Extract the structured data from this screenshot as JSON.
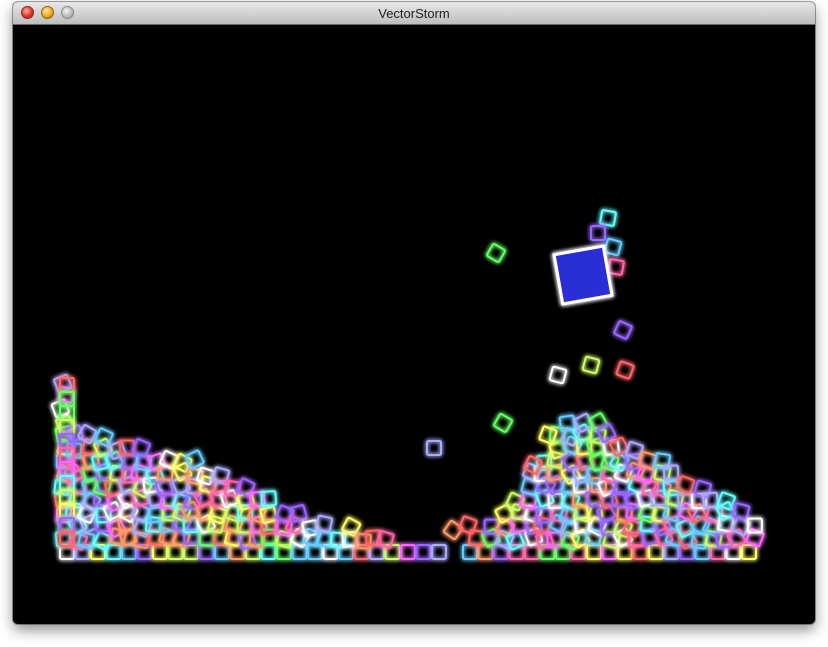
{
  "window": {
    "title": "VectorStorm"
  },
  "colors": {
    "background": "#000000",
    "player_fill": "#2b2fd6",
    "player_stroke": "#ffffff",
    "palette": [
      "#ffffff",
      "#ff66ff",
      "#66ffff",
      "#ffff66",
      "#66ff66",
      "#ff6666",
      "#9966ff",
      "#ff9966",
      "#66ccff",
      "#ccff66",
      "#ff66aa",
      "#aaaaff"
    ]
  },
  "icons": [
    "close-button-icon",
    "minimize-button-icon",
    "zoom-button-icon"
  ]
}
